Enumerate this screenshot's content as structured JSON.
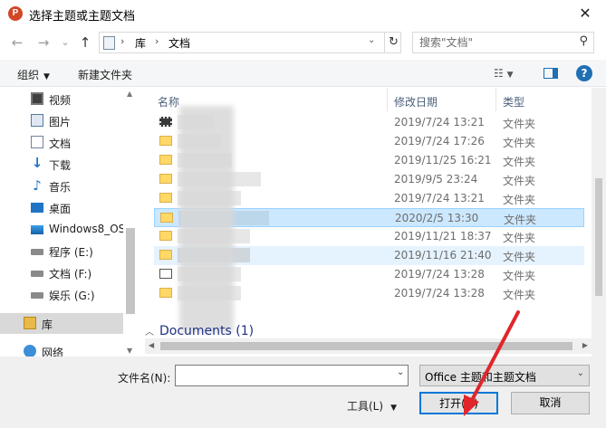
{
  "window": {
    "title": "选择主题或主题文档",
    "close": "✕"
  },
  "nav": {
    "back": "←",
    "forward": "→",
    "recent": "⌄",
    "up": "↑",
    "breadcrumbs": [
      "库",
      "文档"
    ],
    "refresh": "↻"
  },
  "search": {
    "placeholder": "搜索\"文档\""
  },
  "toolbar": {
    "organize": "组织",
    "new_folder": "新建文件夹",
    "help": "?"
  },
  "sidebar": {
    "items": [
      {
        "label": "视频",
        "icon": "video-icon"
      },
      {
        "label": "图片",
        "icon": "picture-icon"
      },
      {
        "label": "文档",
        "icon": "document-icon"
      },
      {
        "label": "下载",
        "icon": "download-icon"
      },
      {
        "label": "音乐",
        "icon": "music-icon"
      },
      {
        "label": "桌面",
        "icon": "desktop-icon"
      },
      {
        "label": "Windows8_OS",
        "icon": "os-drive-icon"
      },
      {
        "label": "程序 (E:)",
        "icon": "drive-icon"
      },
      {
        "label": "文档 (F:)",
        "icon": "drive-icon"
      },
      {
        "label": "娱乐 (G:)",
        "icon": "drive-icon"
      },
      {
        "label": "库",
        "icon": "library-icon"
      },
      {
        "label": "网络",
        "icon": "network-icon"
      }
    ]
  },
  "columns": {
    "name": "名称",
    "modified": "修改日期",
    "type": "类型"
  },
  "files": [
    {
      "date": "2019/7/24 13:21",
      "type": "文件夹"
    },
    {
      "date": "2019/7/24 17:26",
      "type": "文件夹"
    },
    {
      "date": "2019/11/25 16:21",
      "type": "文件夹"
    },
    {
      "date": "2019/9/5 23:24",
      "type": "文件夹"
    },
    {
      "date": "2019/7/24 13:21",
      "type": "文件夹"
    },
    {
      "date": "2020/2/5 13:30",
      "type": "文件夹"
    },
    {
      "date": "2019/11/21 18:37",
      "type": "文件夹"
    },
    {
      "date": "2019/11/16 21:40",
      "type": "文件夹"
    },
    {
      "date": "2019/7/24 13:28",
      "type": "文件夹"
    },
    {
      "date": "2019/7/24 13:28",
      "type": "文件夹"
    }
  ],
  "group": {
    "label": "Documents",
    "count": "(1)"
  },
  "bottom": {
    "filename_label": "文件名(N):",
    "filename_value": "",
    "filter": "Office 主题和主题文档",
    "tools": "工具(L)",
    "open": "打开(O)",
    "cancel": "取消"
  },
  "colors": {
    "accent": "#0078d7",
    "selected_row": "#cce8ff",
    "annotation_arrow": "#e0262b"
  }
}
